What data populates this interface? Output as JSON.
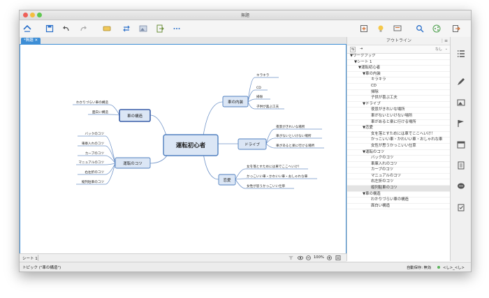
{
  "window": {
    "title": "無題"
  },
  "tab": {
    "label": "*無題 ✕"
  },
  "mindmap": {
    "central": "運転初心者",
    "topics": [
      {
        "label": "車の内装",
        "children": [
          "キラキラ",
          "CD",
          "掃除",
          "子供が喜ぶ工夫"
        ]
      },
      {
        "label": "ドライブ",
        "children": [
          "夜景がきれいな場所",
          "車がないといけない場所",
          "車があると楽に行ける場所"
        ]
      },
      {
        "label": "恋愛",
        "children": [
          "女を落とすためには車でここへいけ！",
          "かっこいい車・かわいい車・おしゃれな車",
          "女性が思うかっこいい仕草"
        ]
      },
      {
        "label": "車の構造",
        "children": [
          "わかりづらい車の構造",
          "面白い構造"
        ]
      },
      {
        "label": "運転のコツ",
        "children": [
          "バックのコツ",
          "車庫入れのコツ",
          "カーブのコツ",
          "マニュアルのコツ",
          "右左折のコツ",
          "縦列駐車のコツ"
        ]
      }
    ]
  },
  "sheet": {
    "label": "シート 1",
    "zoom": "100%"
  },
  "status": {
    "left": "トピック (\"車の構造\")",
    "autosave": "自動保存: 無効",
    "user": "<し>_<し>"
  },
  "outline": {
    "title": "アウトライン",
    "sort_label": "なし",
    "rows": [
      {
        "text": "▼ワークブック",
        "indent": 0
      },
      {
        "text": "▼シート 1",
        "indent": 1
      },
      {
        "text": "▼運転初心者",
        "indent": 2
      },
      {
        "text": "▼車の内装",
        "indent": 3
      },
      {
        "text": "キラキラ",
        "indent": 5
      },
      {
        "text": "CD",
        "indent": 5
      },
      {
        "text": "掃除",
        "indent": 5
      },
      {
        "text": "子供が喜ぶ工夫",
        "indent": 5
      },
      {
        "text": "▼ドライブ",
        "indent": 3
      },
      {
        "text": "夜景がきれいな場所",
        "indent": 5
      },
      {
        "text": "車がないといけない場所",
        "indent": 5
      },
      {
        "text": "車があると楽に行ける場所",
        "indent": 5
      },
      {
        "text": "▼恋愛",
        "indent": 3
      },
      {
        "text": "女を落とすためには車でここへいけ！",
        "indent": 5
      },
      {
        "text": "かっこいい車・かわいい車・おしゃれな車",
        "indent": 5
      },
      {
        "text": "女性が思うかっこいい仕草",
        "indent": 5
      },
      {
        "text": "▼運転のコツ",
        "indent": 3
      },
      {
        "text": "バックのコツ",
        "indent": 5
      },
      {
        "text": "車庫入れのコツ",
        "indent": 5
      },
      {
        "text": "カーブのコツ",
        "indent": 5
      },
      {
        "text": "マニュアルのコツ",
        "indent": 5
      },
      {
        "text": "右左折のコツ",
        "indent": 5
      },
      {
        "text": "縦列駐車のコツ",
        "indent": 5,
        "selected": true
      },
      {
        "text": "▼車の構造",
        "indent": 3
      },
      {
        "text": "わかりづらい車の構造",
        "indent": 5
      },
      {
        "text": "面白い構造",
        "indent": 5
      }
    ]
  },
  "colors": {
    "accent": "#3d8ed6",
    "node_fill": "#dbe6f5",
    "node_border": "#4f7fbf",
    "line": "#6f93c8"
  }
}
